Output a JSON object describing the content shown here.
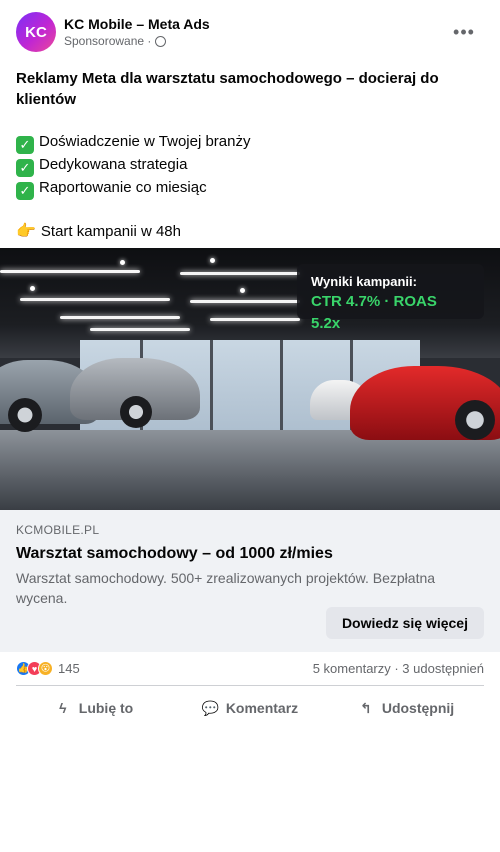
{
  "post": {
    "avatar_text": "KC",
    "page_name": "KC Mobile – Meta Ads",
    "sponsored_label": "Sponsorowane ·",
    "more_icon": "more-horizontal-icon",
    "headline": "Reklamy Meta dla warsztatu samochodowego – docieraj do klientów",
    "benefits": [
      "Doświadczenie w Twojej branży",
      "Dedykowana strategia",
      "Raportowanie co miesiąc"
    ],
    "check_glyph": "✓",
    "start_line": "Start kampanii w 48h"
  },
  "media": {
    "badge_title": "Wyniki kampanii:",
    "badge_value": "CTR 4.7% · ROAS 5.2x",
    "accent_green": "#39d46a"
  },
  "link_preview": {
    "domain": "KCMOBILE.PL",
    "title": "Warsztat samochodowy – od 1000 zł/mies",
    "description": "Warsztat samochodowy. 500+ zrealizowanych projektów. Bezpłatna wycena.",
    "cta_label": "Dowiedz się więcej"
  },
  "reactions": {
    "count": "145",
    "summary": "5 komentarzy · 3 udostępnień"
  },
  "actions": {
    "like": "Lubię to",
    "comment": "Komentarz",
    "share": "Udostępnij"
  },
  "colors": {
    "text_primary": "#050505",
    "text_secondary": "#65676b",
    "surface": "#f0f2f5",
    "button": "#e4e6eb",
    "brand_blue": "#1877f2"
  }
}
